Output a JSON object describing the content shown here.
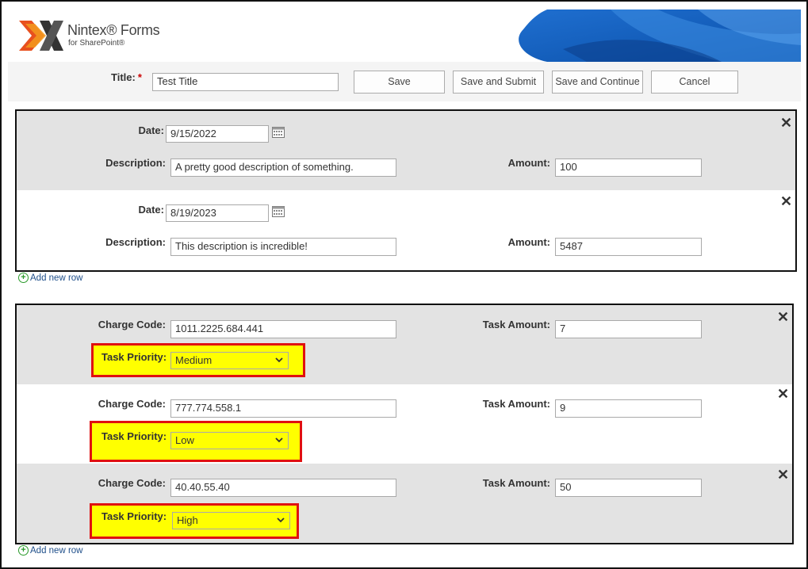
{
  "brand": {
    "name": "Nintex® Forms",
    "sub": "for SharePoint®"
  },
  "title_field": {
    "label": "Title:",
    "required_marker": "*",
    "value": "Test Title"
  },
  "toolbar": {
    "save": "Save",
    "save_submit": "Save and Submit",
    "save_continue": "Save and Continue",
    "cancel": "Cancel"
  },
  "expense_rows": [
    {
      "date_label": "Date:",
      "date": "9/15/2022",
      "desc_label": "Description:",
      "description": "A pretty good description of something.",
      "amount_label": "Amount:",
      "amount": "100"
    },
    {
      "date_label": "Date:",
      "date": "8/19/2023",
      "desc_label": "Description:",
      "description": "This description is incredible!",
      "amount_label": "Amount:",
      "amount": "5487"
    }
  ],
  "task_rows": [
    {
      "code_label": "Charge Code:",
      "charge_code": "1011.2225.684.441",
      "task_amount_label": "Task Amount:",
      "task_amount": "7",
      "priority_label": "Task Priority:",
      "priority": "Medium"
    },
    {
      "code_label": "Charge Code:",
      "charge_code": "777.774.558.1",
      "task_amount_label": "Task Amount:",
      "task_amount": "9",
      "priority_label": "Task Priority:",
      "priority": "Low"
    },
    {
      "code_label": "Charge Code:",
      "charge_code": "40.40.55.40",
      "task_amount_label": "Task Amount:",
      "task_amount": "50",
      "priority_label": "Task Priority:",
      "priority": "High"
    }
  ],
  "add_row_label": "Add new row",
  "icons": {
    "close": "close-icon",
    "calendar": "calendar-icon",
    "add": "add-circle-icon",
    "chevron": "chevron-down-icon"
  },
  "colors": {
    "highlight": "#ffff00",
    "highlight_border": "#e01010",
    "link": "#1f4f8a"
  }
}
